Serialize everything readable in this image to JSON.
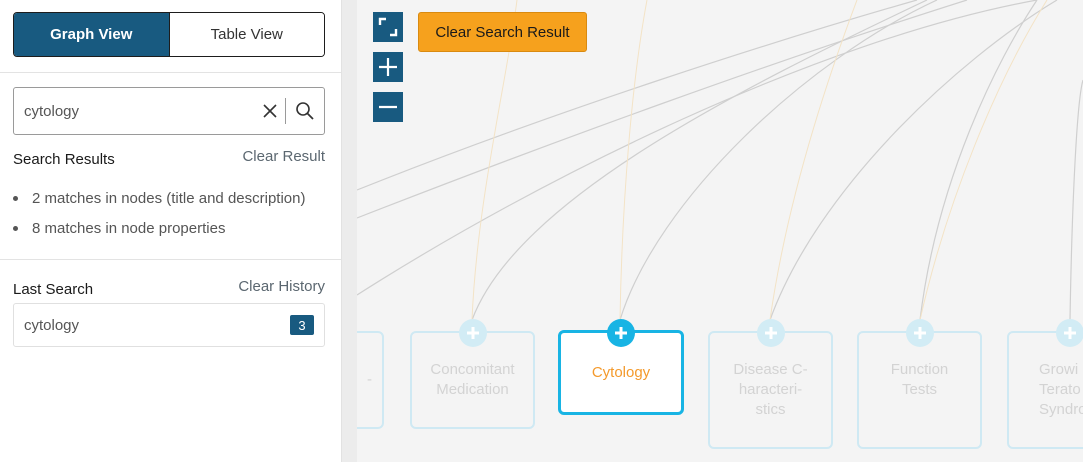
{
  "sidebar": {
    "tabs": {
      "graph": "Graph View",
      "table": "Table View"
    },
    "search": {
      "value": "cytology",
      "placeholder": ""
    },
    "results": {
      "title": "Search Results",
      "clear_label": "Clear Result",
      "items": [
        "2 matches in nodes (title and description)",
        "8 matches in node properties"
      ]
    },
    "history": {
      "title": "Last Search",
      "clear_label": "Clear History",
      "items": [
        {
          "term": "cytology",
          "count": "3"
        }
      ]
    }
  },
  "canvas": {
    "controls": {
      "fit": "expand-icon",
      "zoom_in": "plus-icon",
      "zoom_out": "minus-icon"
    },
    "clear_search_label": "Clear Search Result",
    "nodes": [
      {
        "label": "-"
      },
      {
        "label": "Concomitant\nMedication"
      },
      {
        "label": "Cytology",
        "active": true
      },
      {
        "label": "Disease C-\nharacteri-\nstics"
      },
      {
        "label": "Function\nTests"
      },
      {
        "label": "Growi\nTerato\nSyndro"
      }
    ]
  },
  "colors": {
    "primary": "#185a80",
    "accent": "#f6a11d",
    "highlight": "#18b4e4",
    "node_text_active": "#f49a2c"
  }
}
